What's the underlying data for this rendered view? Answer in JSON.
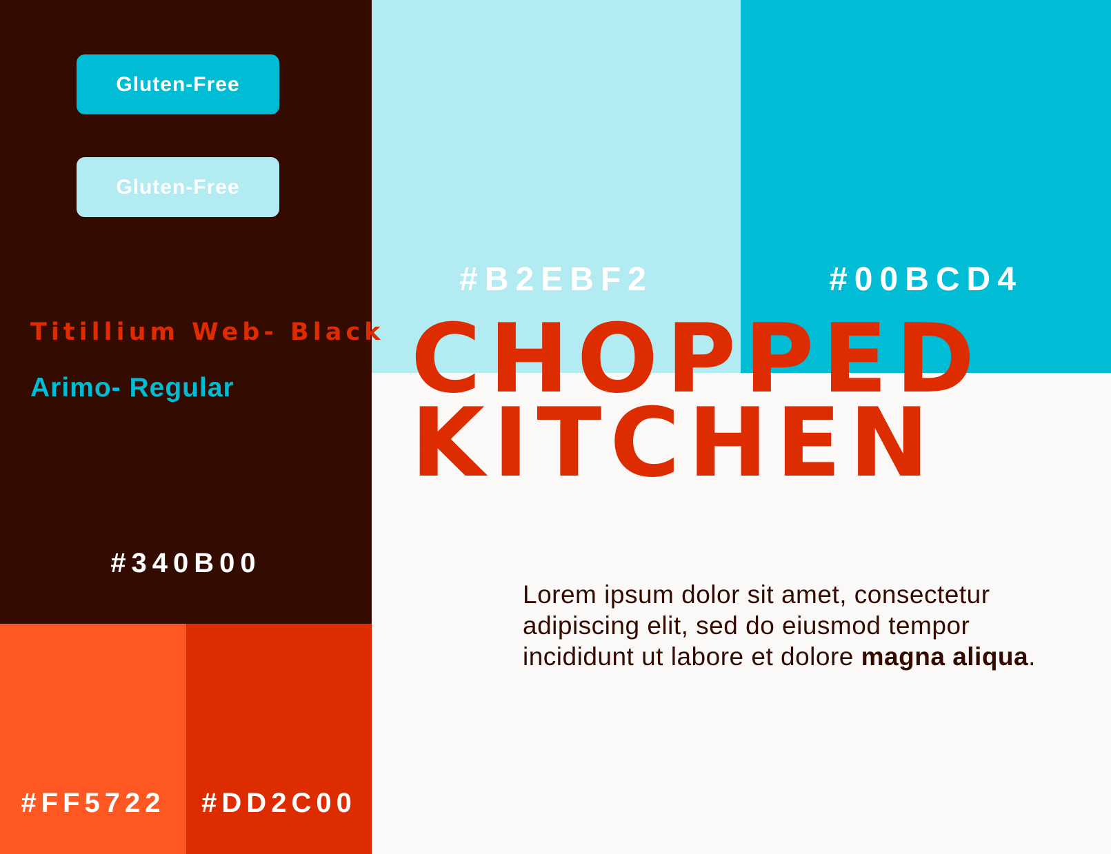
{
  "buttons": {
    "primary_label": "Gluten-Free",
    "secondary_label": "Gluten-Free"
  },
  "fonts": {
    "heading_sample": "Titillium Web- Black",
    "body_sample": "Arimo- Regular"
  },
  "swatches": {
    "light_cyan": "#B2EBF2",
    "cyan": "#00BCD4",
    "dark_brown": "#340B00",
    "orange": "#FF5722",
    "red": "#DD2C00"
  },
  "headline": {
    "line1": "CHOPPED",
    "line2": "KITCHEN"
  },
  "body": {
    "line1": "Lorem ipsum dolor sit amet, consectetur",
    "line2": "adipiscing elit, sed do eiusmod tempor",
    "line3_regular": "incididunt ut labore et dolore ",
    "line3_bold": "magna aliqua",
    "line3_end": "."
  }
}
